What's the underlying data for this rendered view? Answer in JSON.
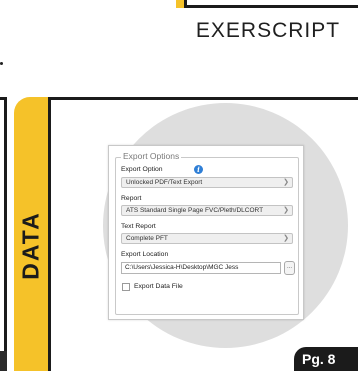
{
  "header": {
    "title": "EXERSCRIPT"
  },
  "tab": {
    "label": "DATA"
  },
  "dialog": {
    "group_title": "Export Options",
    "export_option_label": "Export Option",
    "export_option_value": "Unlocked PDF/Text Export",
    "report_label": "Report",
    "report_value": "ATS Standard Single Page FVC/Pleth/DLCORT",
    "text_report_label": "Text Report",
    "text_report_value": "Complete PFT",
    "export_location_label": "Export Location",
    "export_location_value": "C:\\Users\\Jessica-H\\Desktop\\MGC Jess",
    "browse_label": "...",
    "export_data_file_label": "Export Data File",
    "export_data_file_checked": false
  },
  "footer": {
    "page_label": "Pg. 8"
  },
  "colors": {
    "accent": "#f5c229",
    "dark": "#1b1b1b",
    "circle": "#dedede",
    "info": "#2f7fd6"
  },
  "icons": {
    "info": "info-icon",
    "dropdown": "chevron-down-icon"
  }
}
